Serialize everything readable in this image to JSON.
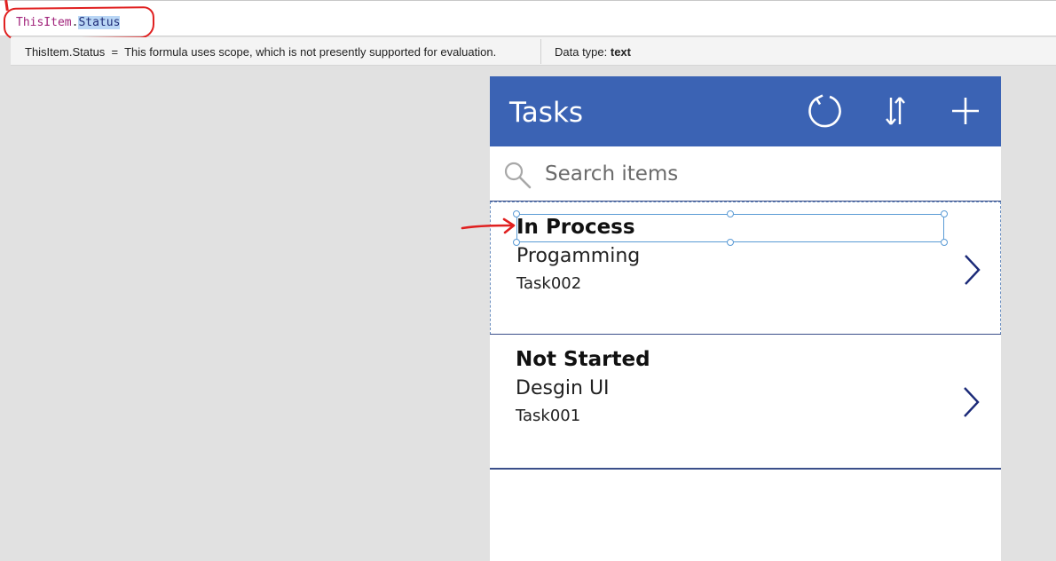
{
  "formula": {
    "identifier": "ThisItem",
    "dot": ".",
    "property": "Status"
  },
  "eval_bar": {
    "expression": "ThisItem.Status  =  This formula uses scope, which is not presently supported for evaluation.",
    "data_type_label": "Data type: ",
    "data_type_value": "text"
  },
  "app": {
    "title": "Tasks",
    "header_icons": [
      "refresh-icon",
      "sort-icon",
      "add-icon"
    ],
    "search": {
      "placeholder": "Search items",
      "value": ""
    },
    "items": [
      {
        "status": "In Process",
        "title": "Progamming",
        "subtitle": "Task002",
        "selected": true
      },
      {
        "status": "Not Started",
        "title": "Desgin UI",
        "subtitle": "Task001",
        "selected": false
      }
    ]
  },
  "colors": {
    "header": "#3b63b4",
    "annotation": "#e02020",
    "selection": "#5b9bd5",
    "identifier": "#a0227a"
  }
}
